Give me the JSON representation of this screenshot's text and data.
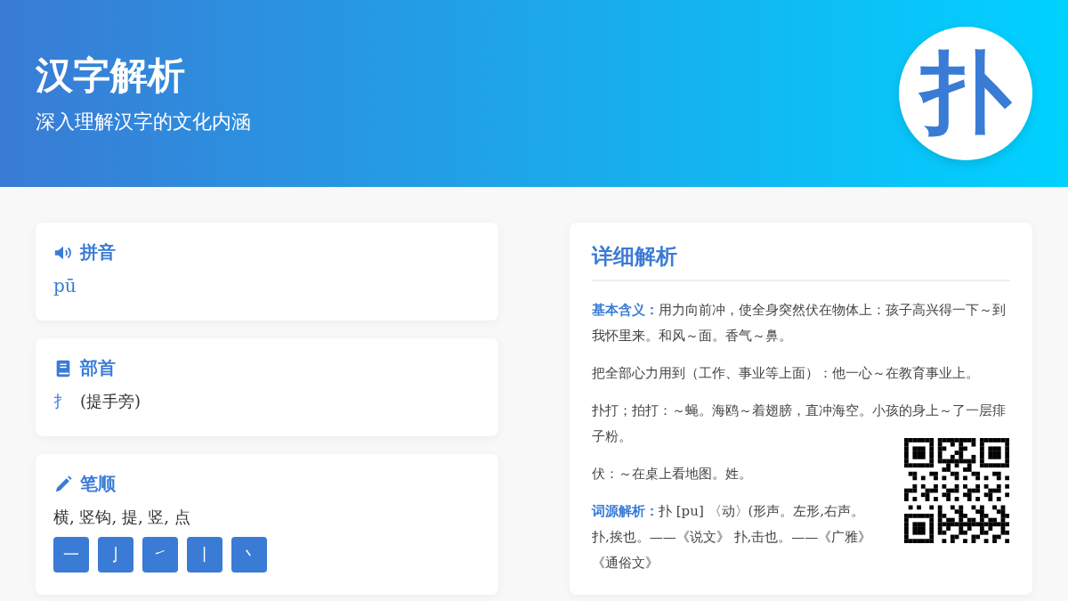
{
  "header": {
    "title": "汉字解析",
    "subtitle": "深入理解汉字的文化内涵",
    "character": "扑"
  },
  "cards": [
    {
      "kind": "pinyin",
      "title": "拼音",
      "value": "pū"
    },
    {
      "kind": "radical",
      "title": "部首",
      "radical": "扌",
      "name": "(提手旁)"
    },
    {
      "kind": "strokes",
      "title": "笔顺",
      "sequence": "横, 竖钩, 提, 竖, 点",
      "strokes": [
        "一",
        "亅",
        "㇀",
        "丨",
        "丶"
      ]
    }
  ],
  "detail": {
    "title": "详细解析",
    "paragraphs": [
      {
        "label": "基本含义：",
        "text": "用力向前冲，使全身突然伏在物体上：孩子高兴得一下～到我怀里来。和风～面。香气～鼻。"
      },
      {
        "text": "把全部心力用到（工作、事业等上面）：他一心～在教育事业上。"
      },
      {
        "text": "扑打；拍打：～蝇。海鸥～着翅膀，直冲海空。小孩的身上～了一层痱子粉。"
      },
      {
        "text": "伏：～在桌上看地图。姓。"
      }
    ],
    "etymology": {
      "label": "词源解析：",
      "lines": [
        "扑 [pu] 〈动〉(形声。左形,右声。",
        "扑,挨也。——《说文》 扑,击也。——《广雅》",
        "《通俗文》"
      ]
    }
  }
}
